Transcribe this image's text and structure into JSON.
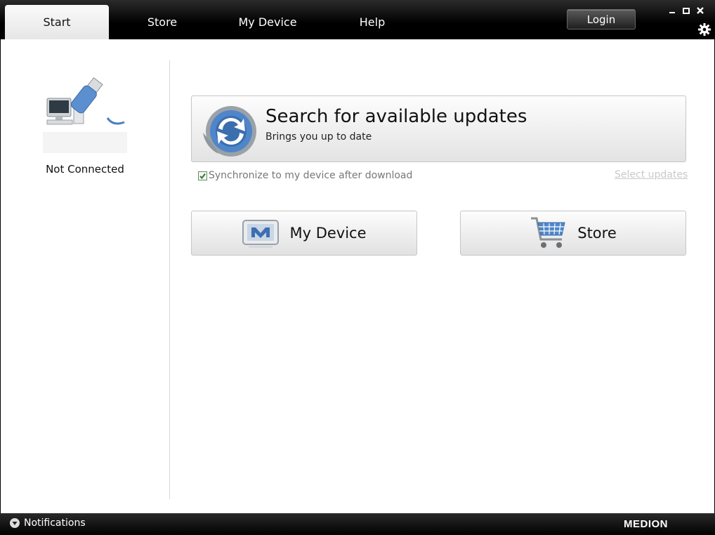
{
  "tabs": [
    {
      "label": "Start",
      "active": true
    },
    {
      "label": "Store",
      "active": false
    },
    {
      "label": "My Device",
      "active": false
    },
    {
      "label": "Help",
      "active": false
    }
  ],
  "header": {
    "login_label": "Login",
    "minimize": "‒",
    "maximize": "□",
    "close": "✕"
  },
  "device_status": {
    "text": "Not Connected",
    "icon": "usb-computer-icon"
  },
  "updates_button": {
    "title": "Search for available updates",
    "subtitle": "Brings you up to date",
    "icon": "refresh-icon"
  },
  "sync": {
    "label": "Synchronize to my device after download",
    "checked": true
  },
  "select_updates_label": "Select updates",
  "buttons": {
    "my_device": {
      "label": "My Device",
      "icon": "device-icon"
    },
    "store": {
      "label": "Store",
      "icon": "cart-icon"
    }
  },
  "footer": {
    "notifications_label": "Notifications",
    "logo": "MEDION"
  },
  "colors": {
    "accent_blue": "#4a86c8",
    "bar_dark": "#000000"
  }
}
